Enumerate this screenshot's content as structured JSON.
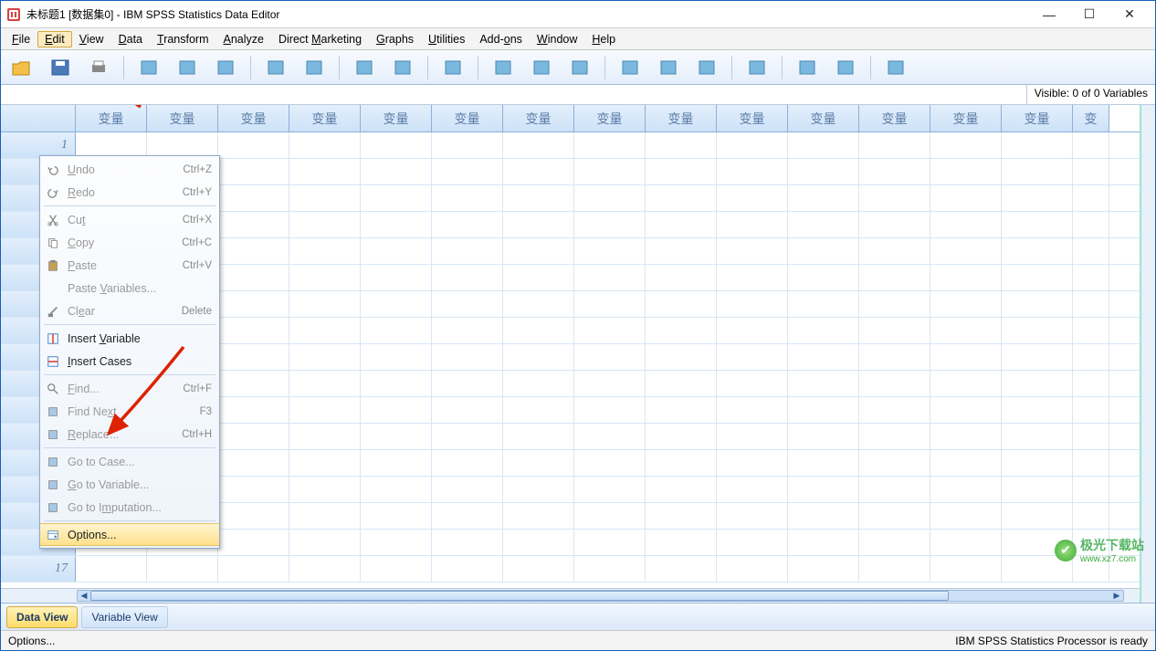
{
  "titlebar": {
    "title": "未标题1 [数据集0] - IBM SPSS Statistics Data Editor"
  },
  "menubar": {
    "items": [
      {
        "label": "File",
        "ul": "F"
      },
      {
        "label": "Edit",
        "ul": "E"
      },
      {
        "label": "View",
        "ul": "V"
      },
      {
        "label": "Data",
        "ul": "D"
      },
      {
        "label": "Transform",
        "ul": "T"
      },
      {
        "label": "Analyze",
        "ul": "A"
      },
      {
        "label": "Direct Marketing",
        "ul": "M"
      },
      {
        "label": "Graphs",
        "ul": "G"
      },
      {
        "label": "Utilities",
        "ul": "U"
      },
      {
        "label": "Add-ons",
        "ul": "o"
      },
      {
        "label": "Window",
        "ul": "W"
      },
      {
        "label": "Help",
        "ul": "H"
      }
    ]
  },
  "dropdown": {
    "items": [
      {
        "label": "Undo",
        "ul": "U",
        "shortcut": "Ctrl+Z",
        "icon": "undo",
        "disabled": true
      },
      {
        "label": "Redo",
        "ul": "R",
        "shortcut": "Ctrl+Y",
        "icon": "redo",
        "disabled": true
      },
      {
        "sep": true
      },
      {
        "label": "Cut",
        "ul": "t",
        "shortcut": "Ctrl+X",
        "icon": "cut",
        "disabled": true
      },
      {
        "label": "Copy",
        "ul": "C",
        "shortcut": "Ctrl+C",
        "icon": "copy",
        "disabled": true
      },
      {
        "label": "Paste",
        "ul": "P",
        "shortcut": "Ctrl+V",
        "icon": "paste",
        "disabled": true
      },
      {
        "label": "Paste Variables...",
        "ul": "V",
        "disabled": true
      },
      {
        "label": "Clear",
        "ul": "e",
        "shortcut": "Delete",
        "icon": "clear",
        "disabled": true
      },
      {
        "sep": true
      },
      {
        "label": "Insert Variable",
        "ul": "V",
        "icon": "insert-var"
      },
      {
        "label": "Insert Cases",
        "ul": "I",
        "icon": "insert-case"
      },
      {
        "sep": true
      },
      {
        "label": "Find...",
        "ul": "F",
        "shortcut": "Ctrl+F",
        "icon": "find",
        "disabled": true
      },
      {
        "label": "Find Next",
        "ul": "x",
        "shortcut": "F3",
        "icon": "find-next",
        "disabled": true
      },
      {
        "label": "Replace...",
        "ul": "R",
        "shortcut": "Ctrl+H",
        "icon": "replace",
        "disabled": true
      },
      {
        "sep": true
      },
      {
        "label": "Go to Case...",
        "ul": "S",
        "icon": "goto-case",
        "disabled": true
      },
      {
        "label": "Go to Variable...",
        "ul": "G",
        "icon": "goto-var",
        "disabled": true
      },
      {
        "label": "Go to Imputation...",
        "ul": "m",
        "icon": "goto-imp",
        "disabled": true
      },
      {
        "sep": true
      },
      {
        "label": "Options...",
        "ul": "N",
        "icon": "options",
        "highlight": true
      }
    ]
  },
  "toolbar": {
    "icons": [
      "open",
      "save",
      "print",
      "sep",
      "recall",
      "undo",
      "redo",
      "sep",
      "goto-var",
      "goto-case",
      "sep",
      "variables",
      "run",
      "sep",
      "find",
      "sep",
      "insert-case",
      "insert-var",
      "split",
      "sep",
      "weight",
      "select",
      "value-labels",
      "sep",
      "use-sets",
      "sep",
      "show-all",
      "show-selected",
      "sep",
      "spell"
    ]
  },
  "info": {
    "visible": "Visible: 0 of 0 Variables"
  },
  "grid": {
    "col_header": "变量",
    "col_count": 14,
    "row_count": 17
  },
  "tabs": {
    "data_view": "Data View",
    "variable_view": "Variable View"
  },
  "status": {
    "left": "Options...",
    "right": "IBM SPSS Statistics Processor is ready"
  },
  "watermark": {
    "text": "极光下载站",
    "url": "www.xz7.com"
  }
}
